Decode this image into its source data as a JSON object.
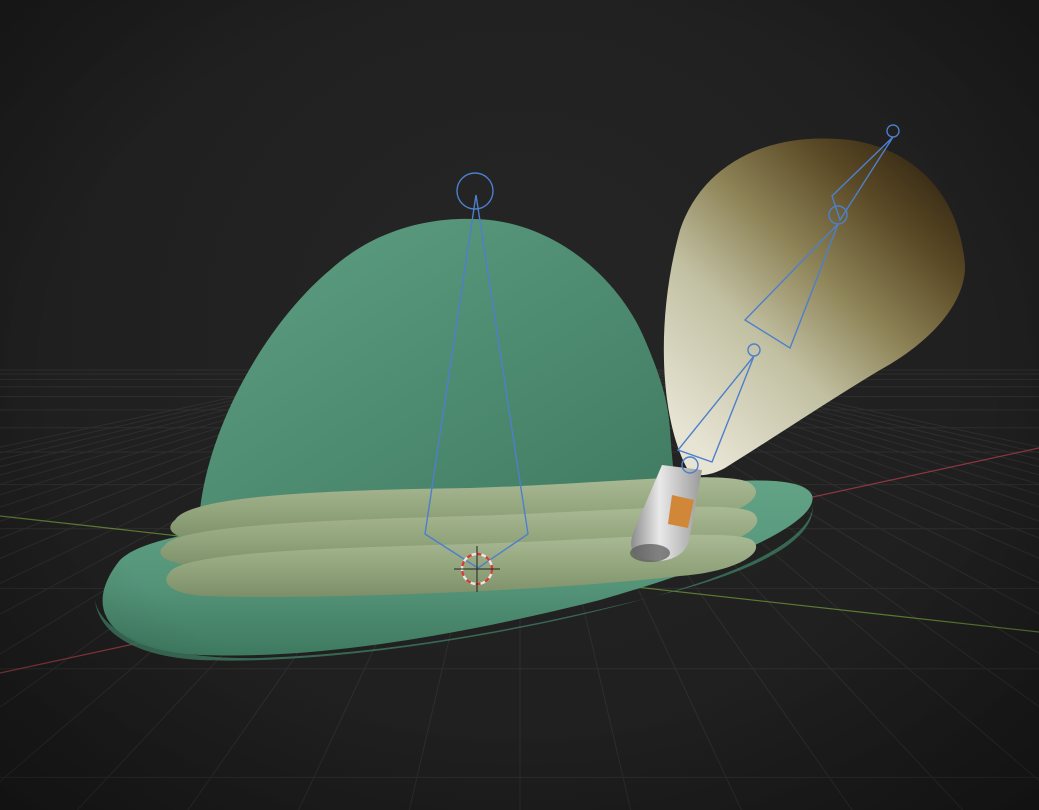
{
  "viewport": {
    "mode": "3d-viewport",
    "background_color": "#232323",
    "grid_color": "#3a3a3a",
    "x_axis_color": "#c0404a",
    "y_axis_color": "#6f9a3a"
  },
  "scene": {
    "objects": [
      {
        "name": "hat-crown",
        "color": "#55957a"
      },
      {
        "name": "hat-brim",
        "color": "#5a9a7f"
      },
      {
        "name": "hat-band",
        "color": "#9fb08a"
      },
      {
        "name": "feather",
        "color_base": "#d8d8c0",
        "color_tip": "#4a3a1e"
      },
      {
        "name": "feather-holder",
        "color": "#c8c8c8",
        "accent_color": "#d08838"
      }
    ],
    "armature_color": "#4d7fcc",
    "cursor_colors": [
      "#e0e0e0",
      "#d04030"
    ]
  }
}
